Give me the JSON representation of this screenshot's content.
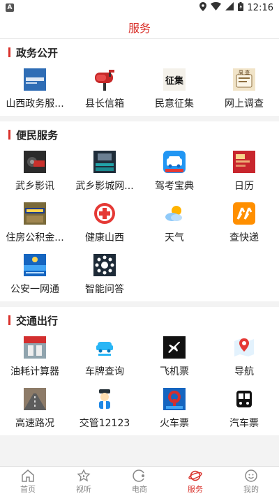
{
  "status_bar": {
    "notification": "A",
    "time": "12:16"
  },
  "header": {
    "title": "服务"
  },
  "sections": [
    {
      "title": "政务公开",
      "items": [
        {
          "label": "山西政务服...",
          "icon": "shanxi-gov-service-icon"
        },
        {
          "label": "县长信箱",
          "icon": "mailbox-icon"
        },
        {
          "label": "民意征集",
          "icon": "opinion-collect-icon"
        },
        {
          "label": "网上调查",
          "icon": "survey-icon"
        }
      ]
    },
    {
      "title": "便民服务",
      "items": [
        {
          "label": "武乡影讯",
          "icon": "film-news-icon"
        },
        {
          "label": "武乡影城网...",
          "icon": "cinema-icon"
        },
        {
          "label": "驾考宝典",
          "icon": "driving-test-icon"
        },
        {
          "label": "日历",
          "icon": "calendar-icon"
        },
        {
          "label": "住房公积金...",
          "icon": "housing-fund-icon"
        },
        {
          "label": "健康山西",
          "icon": "health-icon"
        },
        {
          "label": "天气",
          "icon": "weather-icon"
        },
        {
          "label": "查快递",
          "icon": "express-icon"
        },
        {
          "label": "公安一网通",
          "icon": "police-icon"
        },
        {
          "label": "智能问答",
          "icon": "smart-qa-icon"
        }
      ]
    },
    {
      "title": "交通出行",
      "items": [
        {
          "label": "油耗计算器",
          "icon": "fuel-calc-icon"
        },
        {
          "label": "车牌查询",
          "icon": "license-plate-icon"
        },
        {
          "label": "飞机票",
          "icon": "airplane-icon"
        },
        {
          "label": "导航",
          "icon": "navigation-icon"
        },
        {
          "label": "高速路况",
          "icon": "highway-icon"
        },
        {
          "label": "交管12123",
          "icon": "traffic-police-icon"
        },
        {
          "label": "火车票",
          "icon": "train-icon"
        },
        {
          "label": "汽车票",
          "icon": "bus-icon"
        }
      ]
    }
  ],
  "tabs": [
    {
      "label": "首页",
      "icon": "home-icon",
      "active": false
    },
    {
      "label": "视听",
      "icon": "play-icon",
      "active": false
    },
    {
      "label": "电商",
      "icon": "shop-icon",
      "active": false
    },
    {
      "label": "服务",
      "icon": "service-icon",
      "active": true
    },
    {
      "label": "我的",
      "icon": "profile-icon",
      "active": false
    }
  ],
  "colors": {
    "accent": "#d9312b",
    "background": "#f3f3f3",
    "tab_inactive": "#888888"
  }
}
